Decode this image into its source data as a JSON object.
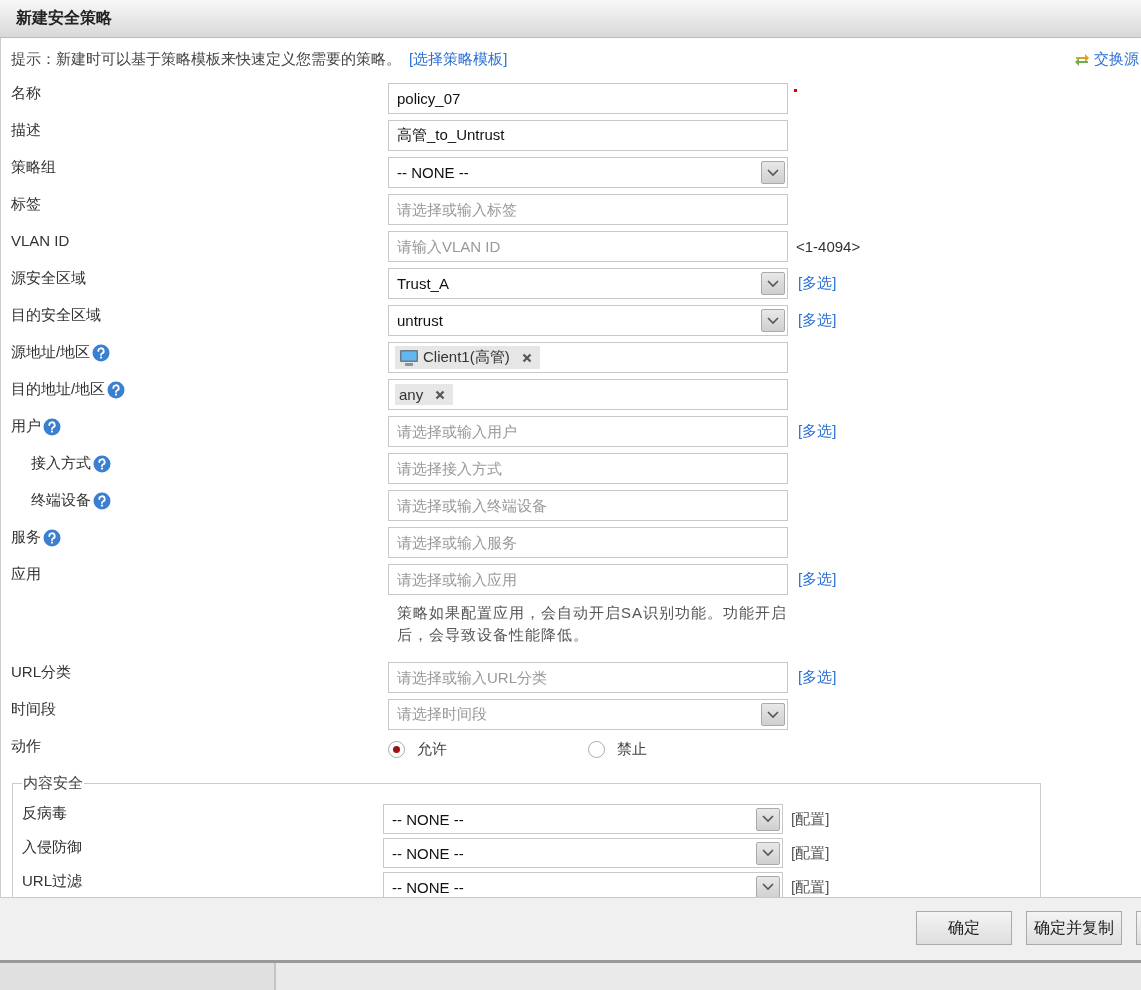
{
  "window": {
    "title": "新建安全策略"
  },
  "hint": {
    "text": "提示：新建时可以基于策略模板来快速定义您需要的策略。",
    "link": "[选择策略模板]"
  },
  "swap_link": "交换源",
  "fields": [
    {
      "label": "名称",
      "kind": "text",
      "value": "policy_07",
      "required": true,
      "help": false,
      "indented": false
    },
    {
      "label": "描述",
      "kind": "text",
      "value": "高管_to_Untrust",
      "required": false,
      "help": false,
      "indented": false
    },
    {
      "label": "策略组",
      "kind": "select",
      "value": "-- NONE --",
      "required": false,
      "help": false,
      "indented": false
    },
    {
      "label": "标签",
      "kind": "text",
      "placeholder": "请选择或输入标签",
      "required": false,
      "help": false,
      "indented": false
    },
    {
      "label": "VLAN ID",
      "kind": "text",
      "placeholder": "请输入VLAN ID",
      "side_text": "<1-4094>",
      "required": false,
      "help": false,
      "indented": false
    },
    {
      "label": "源安全区域",
      "kind": "select",
      "value": "Trust_A",
      "side_link": "[多选]",
      "required": false,
      "help": false,
      "indented": false
    },
    {
      "label": "目的安全区域",
      "kind": "select",
      "value": "untrust",
      "side_link": "[多选]",
      "required": false,
      "help": false,
      "indented": false
    },
    {
      "label": "源地址/地区",
      "kind": "tags",
      "tags": [
        {
          "text": "Client1(高管)",
          "icon": true
        }
      ],
      "required": false,
      "help": true,
      "indented": false
    },
    {
      "label": "目的地址/地区",
      "kind": "tags",
      "tags": [
        {
          "text": "any",
          "icon": false
        }
      ],
      "required": false,
      "help": true,
      "indented": false
    },
    {
      "label": "用户",
      "kind": "text",
      "placeholder": "请选择或输入用户",
      "side_link": "[多选]",
      "required": false,
      "help": true,
      "indented": false
    },
    {
      "label": "接入方式",
      "kind": "text",
      "placeholder": "请选择接入方式",
      "required": false,
      "help": true,
      "indented": true
    },
    {
      "label": "终端设备",
      "kind": "text",
      "placeholder": "请选择或输入终端设备",
      "required": false,
      "help": true,
      "indented": true
    },
    {
      "label": "服务",
      "kind": "text",
      "placeholder": "请选择或输入服务",
      "required": false,
      "help": true,
      "indented": false
    },
    {
      "label": "应用",
      "kind": "text",
      "placeholder": "请选择或输入应用",
      "side_link": "[多选]",
      "required": false,
      "help": false,
      "indented": false
    },
    {
      "kind": "note",
      "text": "策略如果配置应用，会自动开启SA识别功能。功能开启后，会导致设备性能降低。"
    },
    {
      "label": "URL分类",
      "kind": "text",
      "placeholder": "请选择或输入URL分类",
      "side_link": "[多选]",
      "required": false,
      "help": false,
      "indented": false
    },
    {
      "label": "时间段",
      "kind": "select",
      "placeholder": "请选择时间段",
      "required": false,
      "help": false,
      "indented": false
    },
    {
      "label": "动作",
      "kind": "radio",
      "options": [
        {
          "label": "允许",
          "selected": true
        },
        {
          "label": "禁止",
          "selected": false
        }
      ],
      "required": false,
      "help": false,
      "indented": false
    }
  ],
  "content_security": {
    "title": "内容安全",
    "rows": [
      {
        "label": "反病毒",
        "value": "-- NONE --",
        "link": "[配置]"
      },
      {
        "label": "入侵防御",
        "value": "-- NONE --",
        "link": "[配置]"
      },
      {
        "label": "URL过滤",
        "value": "-- NONE --",
        "link": "[配置]"
      }
    ]
  },
  "buttons": [
    {
      "label": "确定"
    },
    {
      "label": "确定并复制"
    }
  ]
}
